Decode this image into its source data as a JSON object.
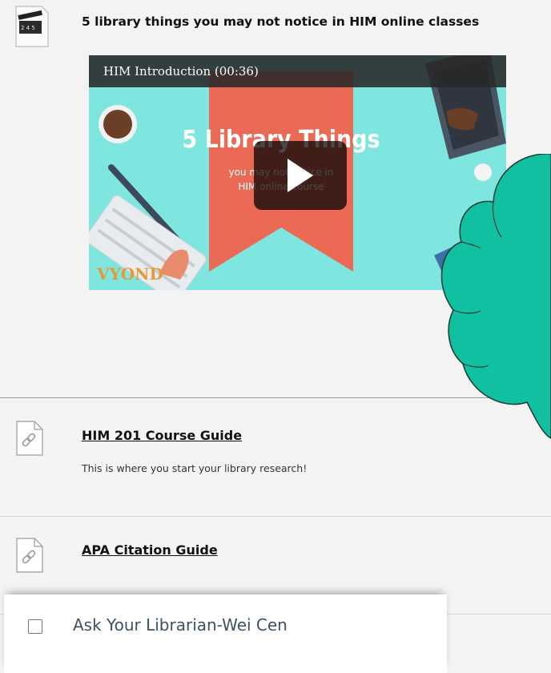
{
  "video_item": {
    "title": "5 library things you may not notice in HIM online classes",
    "video": {
      "bar_title": "HIM Introduction (00:36)",
      "headline": "5 Library Things",
      "subtitle_line1": "you may not notice in",
      "subtitle_line2": "HIM online course",
      "watermark": "VYOND",
      "clapper_digits": "2 4 5"
    }
  },
  "links": [
    {
      "title": "HIM 201 Course Guide",
      "description": "This is where you start your library research!"
    },
    {
      "title": "APA Citation Guide"
    }
  ],
  "ask_librarian": {
    "label": "Ask Your Librarian-Wei Cen",
    "checked": false
  },
  "colors": {
    "cloud": "#10c0a0",
    "video_bg": "#7ee6de",
    "ribbon": "#ea6a55"
  }
}
